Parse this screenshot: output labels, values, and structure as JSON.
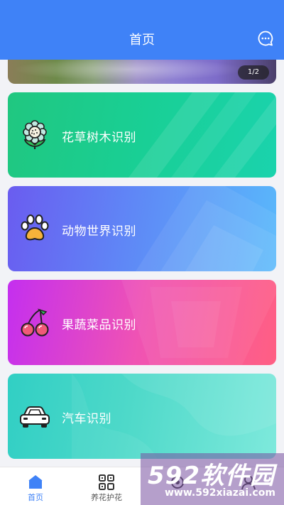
{
  "header": {
    "title": "首页",
    "chat_icon": "chat-bubble-icon"
  },
  "banner": {
    "pager": "1/2"
  },
  "cards": [
    {
      "label": "花草树木识别",
      "icon": "flower-icon",
      "colors": [
        "#20c780",
        "#1ad3ad"
      ]
    },
    {
      "label": "动物世界识别",
      "icon": "paw-icon",
      "colors": [
        "#6a5cf0",
        "#59b9fb"
      ]
    },
    {
      "label": "果蔬菜品识别",
      "icon": "cherry-icon",
      "colors": [
        "#c42fef",
        "#ff5f83"
      ]
    },
    {
      "label": "汽车识别",
      "icon": "car-icon",
      "colors": [
        "#31cfc4",
        "#7ee9dc"
      ]
    }
  ],
  "tabbar": {
    "tabs": [
      {
        "label": "首页",
        "icon": "home-icon",
        "active": true
      },
      {
        "label": "养花护花",
        "icon": "grid-icon",
        "active": false
      },
      {
        "label": "",
        "icon": "camera-icon",
        "active": false
      },
      {
        "label": "",
        "icon": "user-icon",
        "active": false
      }
    ]
  },
  "watermark": {
    "brand": "592软件园",
    "url": "www.592xiazai.com"
  },
  "accent_color": "#3f82f7"
}
